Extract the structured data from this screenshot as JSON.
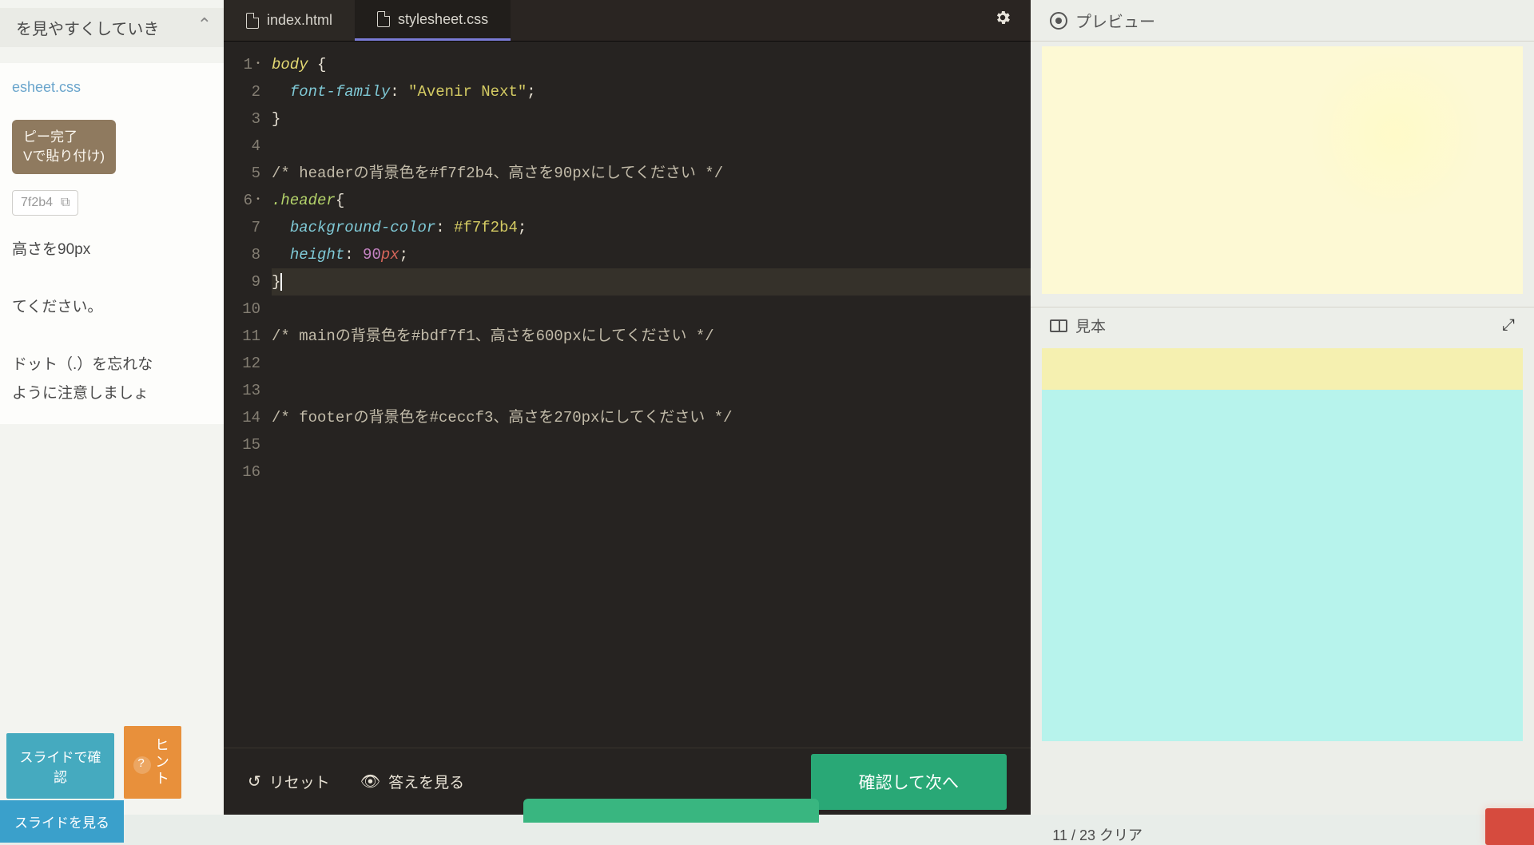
{
  "left": {
    "headerText": "を見やすくしていき",
    "filename": "esheet.css",
    "tooltip_line1": "ピー完了",
    "tooltip_line2": "Vで貼り付け)",
    "copyChipText": "7f2b4",
    "instruction": "高さを90px\n\nてください。\n\nドット（.）を忘れな\nように注意しましょ",
    "confirmButton": "スライドで確認",
    "hintButton": "ヒント",
    "slideViewButton": "スライドを見る"
  },
  "editor": {
    "tabs": [
      {
        "label": "index.html",
        "active": false
      },
      {
        "label": "stylesheet.css",
        "active": true
      }
    ],
    "code": {
      "lines": [
        {
          "n": 1,
          "seg": [
            [
              "sel",
              "body "
            ],
            [
              "brace",
              "{"
            ]
          ],
          "dot": true
        },
        {
          "n": 2,
          "seg": [
            [
              "plain",
              "  "
            ],
            [
              "prop",
              "font-family"
            ],
            [
              "punct",
              ": "
            ],
            [
              "str",
              "\"Avenir Next\""
            ],
            [
              "punct",
              ";"
            ]
          ]
        },
        {
          "n": 3,
          "seg": [
            [
              "brace",
              "}"
            ]
          ]
        },
        {
          "n": 4,
          "seg": []
        },
        {
          "n": 5,
          "seg": [
            [
              "comment",
              "/* headerの背景色を#f7f2b4、高さを90pxにしてください */"
            ]
          ]
        },
        {
          "n": 6,
          "seg": [
            [
              "class",
              ".header"
            ],
            [
              "brace",
              "{"
            ]
          ],
          "dot": true
        },
        {
          "n": 7,
          "seg": [
            [
              "plain",
              "  "
            ],
            [
              "prop",
              "background-color"
            ],
            [
              "punct",
              ": "
            ],
            [
              "str",
              "#f7f2b4"
            ],
            [
              "punct",
              ";"
            ]
          ]
        },
        {
          "n": 8,
          "seg": [
            [
              "plain",
              "  "
            ],
            [
              "prop",
              "height"
            ],
            [
              "punct",
              ": "
            ],
            [
              "num",
              "90"
            ],
            [
              "unit",
              "px"
            ],
            [
              "punct",
              ";"
            ]
          ]
        },
        {
          "n": 9,
          "seg": [
            [
              "brace",
              "}"
            ]
          ],
          "hl": true,
          "cursor": true
        },
        {
          "n": 10,
          "seg": []
        },
        {
          "n": 11,
          "seg": [
            [
              "comment",
              "/* mainの背景色を#bdf7f1、高さを600pxにしてください */"
            ]
          ]
        },
        {
          "n": 12,
          "seg": []
        },
        {
          "n": 13,
          "seg": []
        },
        {
          "n": 14,
          "seg": [
            [
              "comment",
              "/* footerの背景色を#ceccf3、高さを270pxにしてください */"
            ]
          ]
        },
        {
          "n": 15,
          "seg": []
        },
        {
          "n": 16,
          "seg": []
        }
      ]
    },
    "footer": {
      "reset": "リセット",
      "answer": "答えを見る",
      "checkNext": "確認して次へ"
    },
    "progress": "11 / 23 クリア"
  },
  "right": {
    "previewLabel": "プレビュー",
    "sampleLabel": "見本"
  }
}
